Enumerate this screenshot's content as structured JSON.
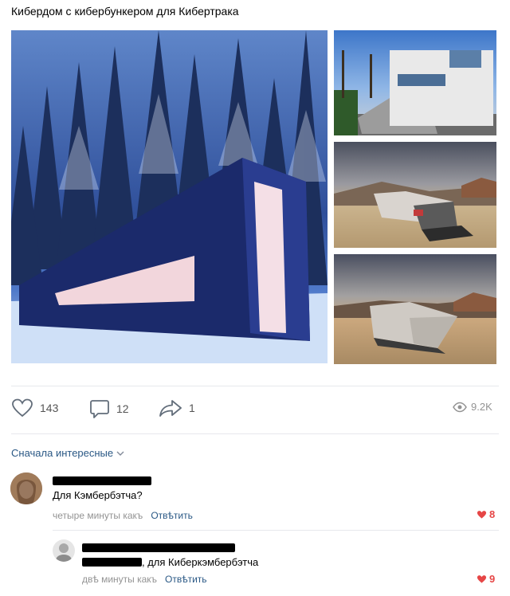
{
  "post": {
    "title": "Кибердом с кибербункером для Кибертрака"
  },
  "actions": {
    "likes": "143",
    "comments": "12",
    "shares": "1",
    "views": "9.2K"
  },
  "comments_section": {
    "sort_label": "Сначала интересные"
  },
  "comments": [
    {
      "text": "Для Кэмбербэтча?",
      "time": "четыре минуты какъ",
      "reply_label": "Отвѣтить",
      "likes": "8"
    },
    {
      "text": ", для Киберкэмбербэтча",
      "time": "двѣ минуты какъ",
      "reply_label": "Отвѣтить",
      "likes": "9"
    }
  ],
  "colors": {
    "link": "#2a5885",
    "like_red": "#e64646",
    "meta_gray": "#939393"
  }
}
